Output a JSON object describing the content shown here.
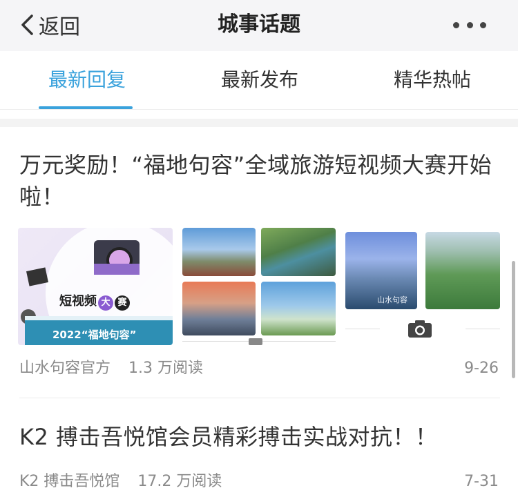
{
  "header": {
    "back_label": "返回",
    "title": "城事话题",
    "back_icon": "chevron-left-icon",
    "more_icon": "more-dots-icon"
  },
  "tabs": [
    {
      "label": "最新回复",
      "active": true
    },
    {
      "label": "最新发布",
      "active": false
    },
    {
      "label": "精华热帖",
      "active": false
    }
  ],
  "accent_color": "#3aa2dc",
  "posts": [
    {
      "title": "万元奖励！“福地句容”全域旅游短视频大赛开始啦！",
      "author": "山水句容官方",
      "reads": "1.3 万阅读",
      "date": "9-26",
      "media": {
        "poster_text": "短视频",
        "poster_badge_1": "大",
        "poster_badge_2": "赛",
        "poster_band_text": "2022“福地句容”",
        "video_watermark": "山水句容"
      }
    },
    {
      "title": "K2 搏击吾悦馆会员精彩搏击实战对抗！！",
      "author": "K2 搏击吾悦馆",
      "reads": "17.2 万阅读",
      "date": "7-31"
    }
  ]
}
